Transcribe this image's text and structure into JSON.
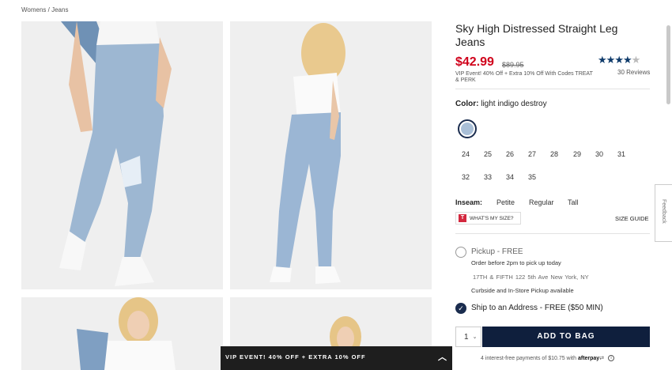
{
  "breadcrumb": {
    "womens": "Womens",
    "sep": " / ",
    "jeans": "Jeans"
  },
  "product": {
    "title": "Sky High Distressed Straight Leg Jeans",
    "sale_price": "$42.99",
    "original_price": "$89.95",
    "promo": "VIP Event! 40% Off + Extra 10% Off With Codes TREAT & PERK",
    "rating": 4.5,
    "reviews": "30 Reviews"
  },
  "color": {
    "label": "Color:",
    "value": "light indigo destroy",
    "swatch_color": "#a9bfd7"
  },
  "sizes": [
    "24",
    "25",
    "26",
    "27",
    "28",
    "29",
    "30",
    "31",
    "32",
    "33",
    "34",
    "35"
  ],
  "inseam": {
    "label": "Inseam:",
    "options": [
      "Petite",
      "Regular",
      "Tall"
    ]
  },
  "whats_my_size": "WHAT'S MY SIZE?",
  "size_guide": "SIZE GUIDE",
  "pickup": {
    "title": "Pickup - FREE",
    "subtitle": "Order before 2pm to pick up today",
    "address": "17TH & FIFTH 122 5th Ave New York, NY",
    "curbside": "Curbside and In-Store Pickup available"
  },
  "ship": {
    "title": "Ship to an Address - FREE ($50 MIN)"
  },
  "quantity": "1",
  "add_to_bag": "ADD TO BAG",
  "afterpay": {
    "text": "4 interest-free payments of $10.75 with",
    "brand": "afterpay"
  },
  "feedback": "Feedback",
  "banner": "VIP EVENT! 40% OFF + EXTRA 10% OFF",
  "colors": {
    "brand_navy": "#0f1f3d",
    "sale_red": "#d0021b",
    "star": "#0f3b6b"
  }
}
